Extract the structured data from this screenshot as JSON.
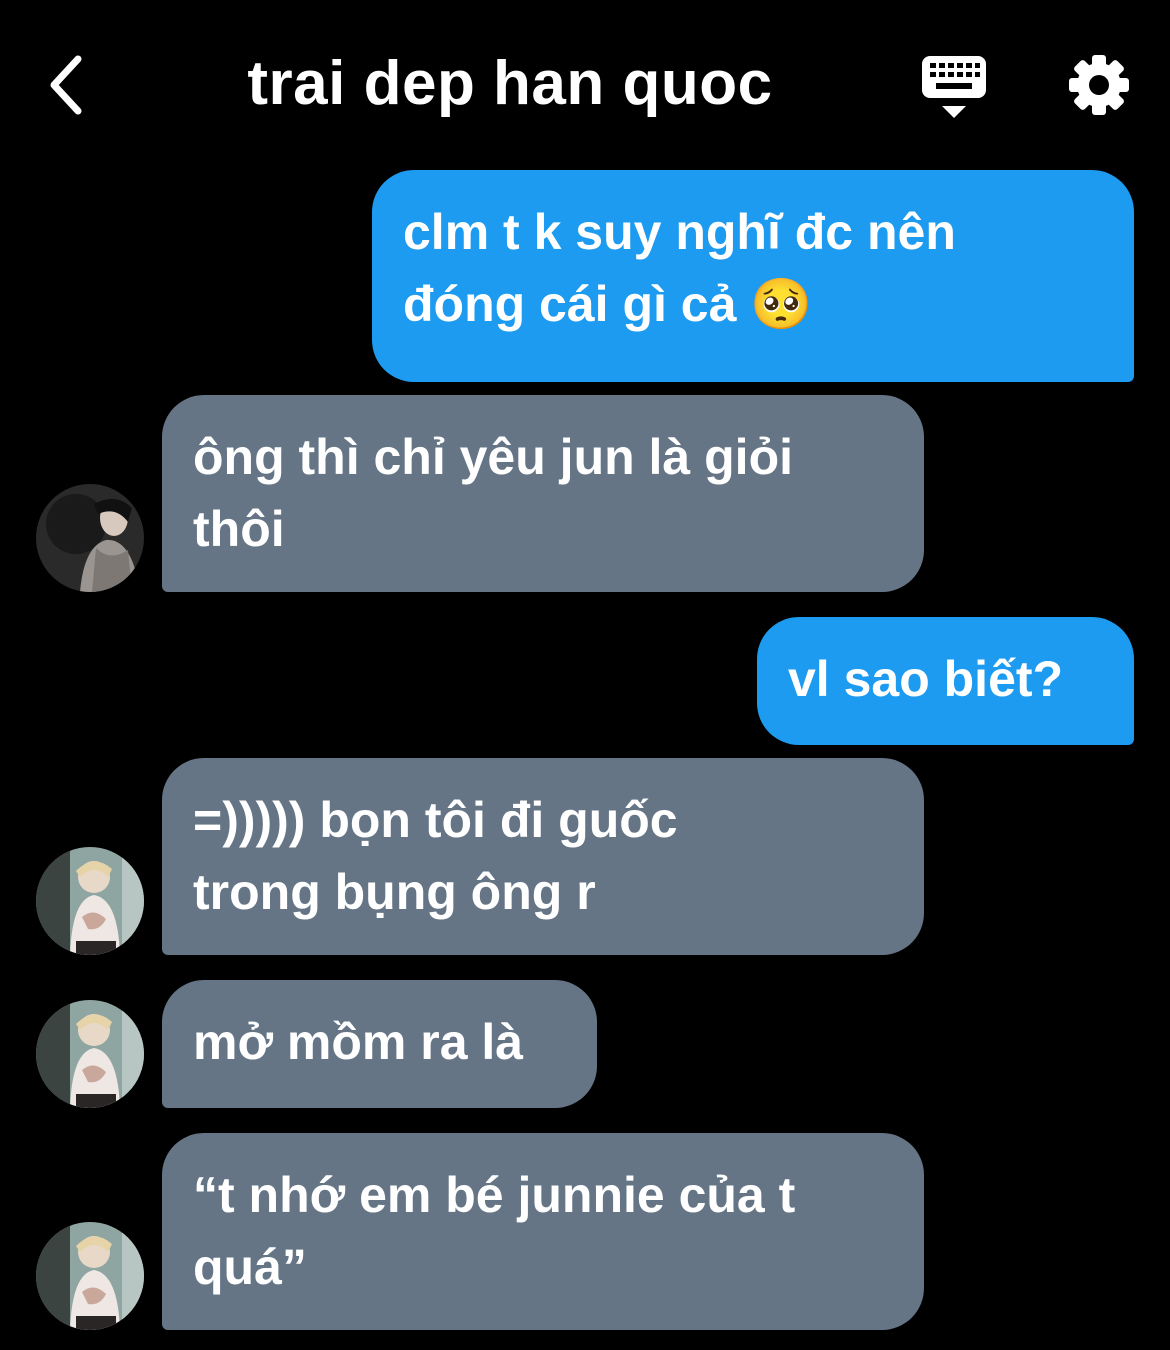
{
  "header": {
    "title": "trai dep han quoc",
    "back_icon": "chevron-left-icon",
    "keyboard_icon": "keyboard-icon",
    "settings_icon": "gear-icon"
  },
  "colors": {
    "background": "#000000",
    "outgoing_bubble": "#1d9bf0",
    "incoming_bubble": "#657586",
    "text": "#ffffff"
  },
  "messages": [
    {
      "direction": "outgoing",
      "lines": [
        "clm t k suy nghĩ đc nên",
        "đóng cái gì cả 🥺"
      ]
    },
    {
      "direction": "incoming",
      "lines": [
        "ông thì chỉ yêu jun là giỏi",
        "thôi"
      ]
    },
    {
      "direction": "outgoing",
      "lines": [
        "vl sao biết?"
      ]
    },
    {
      "direction": "incoming",
      "lines": [
        "=))))) bọn tôi đi guốc",
        "trong bụng ông r"
      ]
    },
    {
      "direction": "incoming",
      "lines": [
        "mở mồm ra là"
      ]
    },
    {
      "direction": "incoming",
      "lines": [
        "“t nhớ em bé junnie của t",
        "quá”"
      ]
    }
  ]
}
